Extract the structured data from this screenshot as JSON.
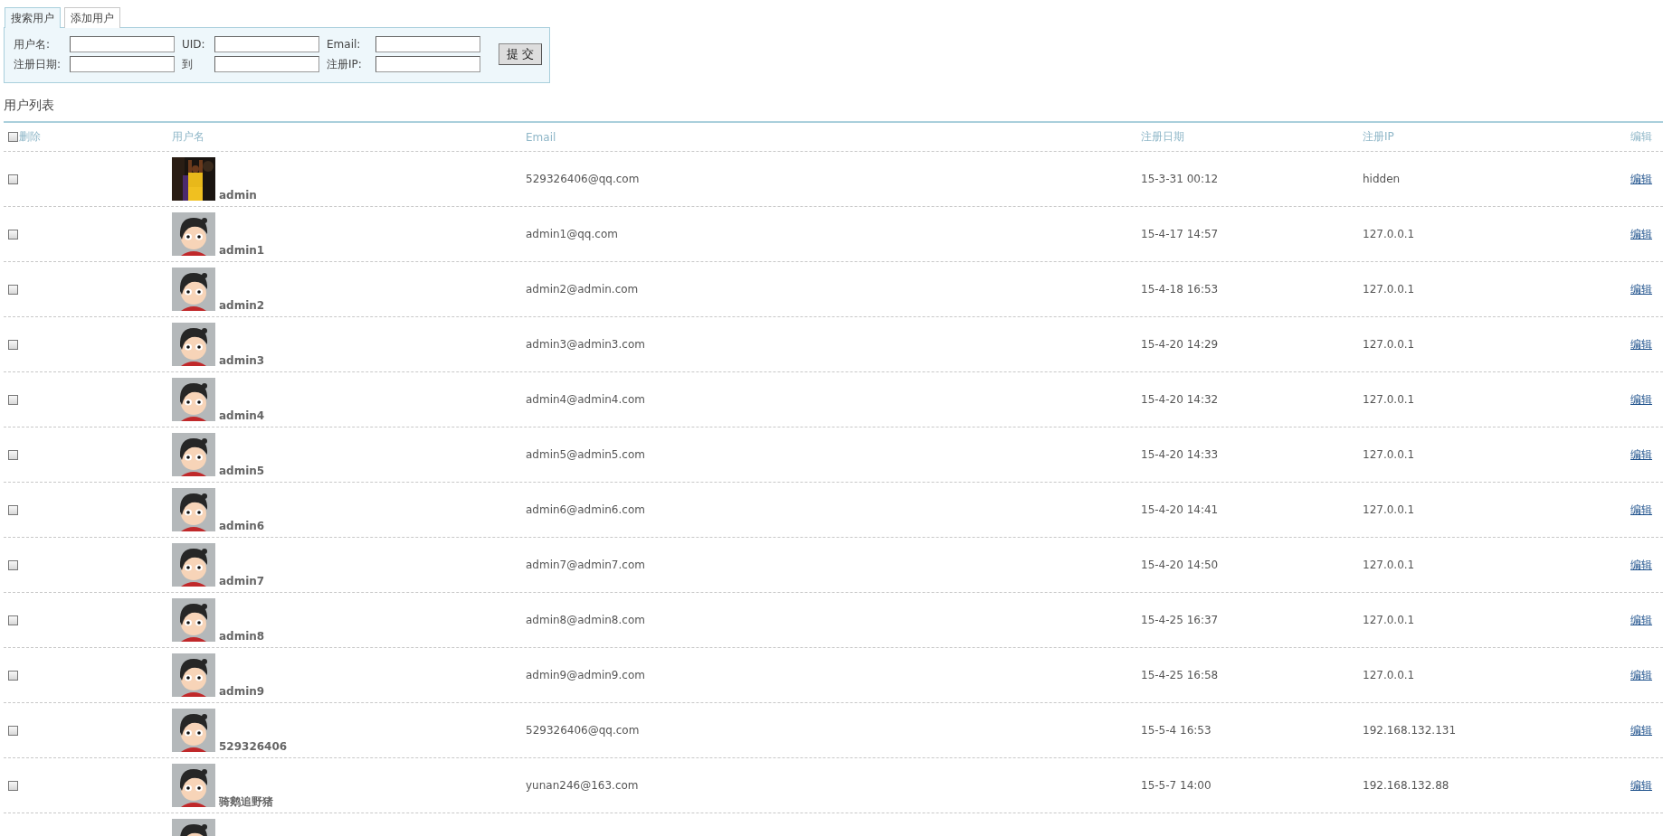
{
  "tabs": [
    {
      "label": "搜索用户",
      "selected": true
    },
    {
      "label": "添加用户",
      "selected": false
    }
  ],
  "search_form": {
    "fields": [
      {
        "label": "用户名:"
      },
      {
        "label": "UID:"
      },
      {
        "label": "Email:"
      },
      {
        "label": "注册日期:"
      },
      {
        "label": "到"
      },
      {
        "label": "注册IP:"
      }
    ],
    "submit": "提 交"
  },
  "section_title": "用户列表",
  "table": {
    "select_all": {
      "checked": false
    },
    "columns": [
      "删除",
      "用户名",
      "Email",
      "注册日期",
      "注册IP",
      "编辑"
    ],
    "rows": [
      {
        "checked": false,
        "username": "admin",
        "email": "529326406@qq.com",
        "registered": "15-3-31 00:12",
        "ip": "hidden",
        "action": "编辑"
      },
      {
        "checked": false,
        "avatar": {
          "kind": "cartoon"
        },
        "username": "admin1",
        "email": "admin1@qq.com",
        "registered": "15-4-17 14:57",
        "ip": "127.0.0.1",
        "action": "编辑"
      },
      {
        "checked": false,
        "avatar": {
          "kind": "cartoon"
        },
        "username": "admin2",
        "email": "admin2@admin.com",
        "registered": "15-4-18 16:53",
        "ip": "127.0.0.1",
        "action": "编辑"
      },
      {
        "checked": false,
        "avatar": {
          "kind": "cartoon"
        },
        "username": "admin3",
        "email": "admin3@admin3.com",
        "registered": "15-4-20 14:29",
        "ip": "127.0.0.1",
        "action": "编辑"
      },
      {
        "checked": false,
        "avatar": {
          "kind": "cartoon"
        },
        "username": "admin4",
        "email": "admin4@admin4.com",
        "registered": "15-4-20 14:32",
        "ip": "127.0.0.1",
        "action": "编辑"
      },
      {
        "checked": false,
        "avatar": {
          "kind": "cartoon"
        },
        "username": "admin5",
        "email": "admin5@admin5.com",
        "registered": "15-4-20 14:33",
        "ip": "127.0.0.1",
        "action": "编辑"
      },
      {
        "checked": false,
        "avatar": {
          "kind": "cartoon"
        },
        "username": "admin6",
        "email": "admin6@admin6.com",
        "registered": "15-4-20 14:41",
        "ip": "127.0.0.1",
        "action": "编辑"
      },
      {
        "checked": false,
        "avatar": {
          "kind": "cartoon"
        },
        "username": "admin7",
        "email": "admin7@admin7.com",
        "registered": "15-4-20 14:50",
        "ip": "127.0.0.1",
        "action": "编辑"
      },
      {
        "checked": false,
        "avatar": {
          "kind": "cartoon"
        },
        "username": "admin8",
        "email": "admin8@admin8.com",
        "registered": "15-4-25 16:37",
        "ip": "127.0.0.1",
        "action": "编辑"
      },
      {
        "checked": false,
        "avatar": {
          "kind": "cartoon"
        },
        "username": "admin9",
        "email": "admin9@admin9.com",
        "registered": "15-4-25 16:58",
        "ip": "127.0.0.1",
        "action": "编辑"
      },
      {
        "checked": false,
        "avatar": {
          "kind": "cartoon"
        },
        "username": "529326406",
        "email": "529326406@qq.com",
        "registered": "15-5-4 16:53",
        "ip": "192.168.132.131",
        "action": "编辑"
      },
      {
        "checked": false,
        "avatar": {
          "kind": "cartoon"
        },
        "username": "骑鹅追野猪",
        "email": "yunan246@163.com",
        "registered": "15-5-7 14:00",
        "ip": "192.168.132.88",
        "action": "编辑"
      },
      {
        "avatar": {
          "kind": "cartoon"
        }
      }
    ]
  }
}
